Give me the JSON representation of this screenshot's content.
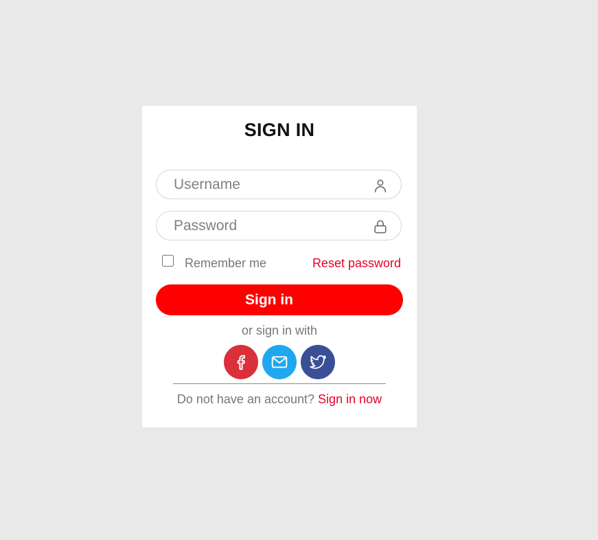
{
  "form": {
    "title": "SIGN IN",
    "username": {
      "placeholder": "Username",
      "value": "",
      "icon": "user-icon"
    },
    "password": {
      "placeholder": "Password",
      "value": "",
      "icon": "lock-icon"
    },
    "remember_label": "Remember me",
    "remember_checked": false,
    "reset_label": "Reset password",
    "submit_label": "Sign in",
    "alt_text": "or sign in with",
    "social": [
      {
        "name": "facebook",
        "icon": "facebook-icon",
        "color": "#d9303a"
      },
      {
        "name": "email",
        "icon": "mail-icon",
        "color": "#1fa7ef"
      },
      {
        "name": "twitter",
        "icon": "twitter-icon",
        "color": "#3b4f97"
      }
    ],
    "footer_text": "Do not have an account?",
    "footer_link": "Sign in now"
  },
  "colors": {
    "background": "#e9e9e9",
    "card": "#ffffff",
    "accent": "#ff0000",
    "link": "#e6002a",
    "muted_text": "#777777"
  }
}
